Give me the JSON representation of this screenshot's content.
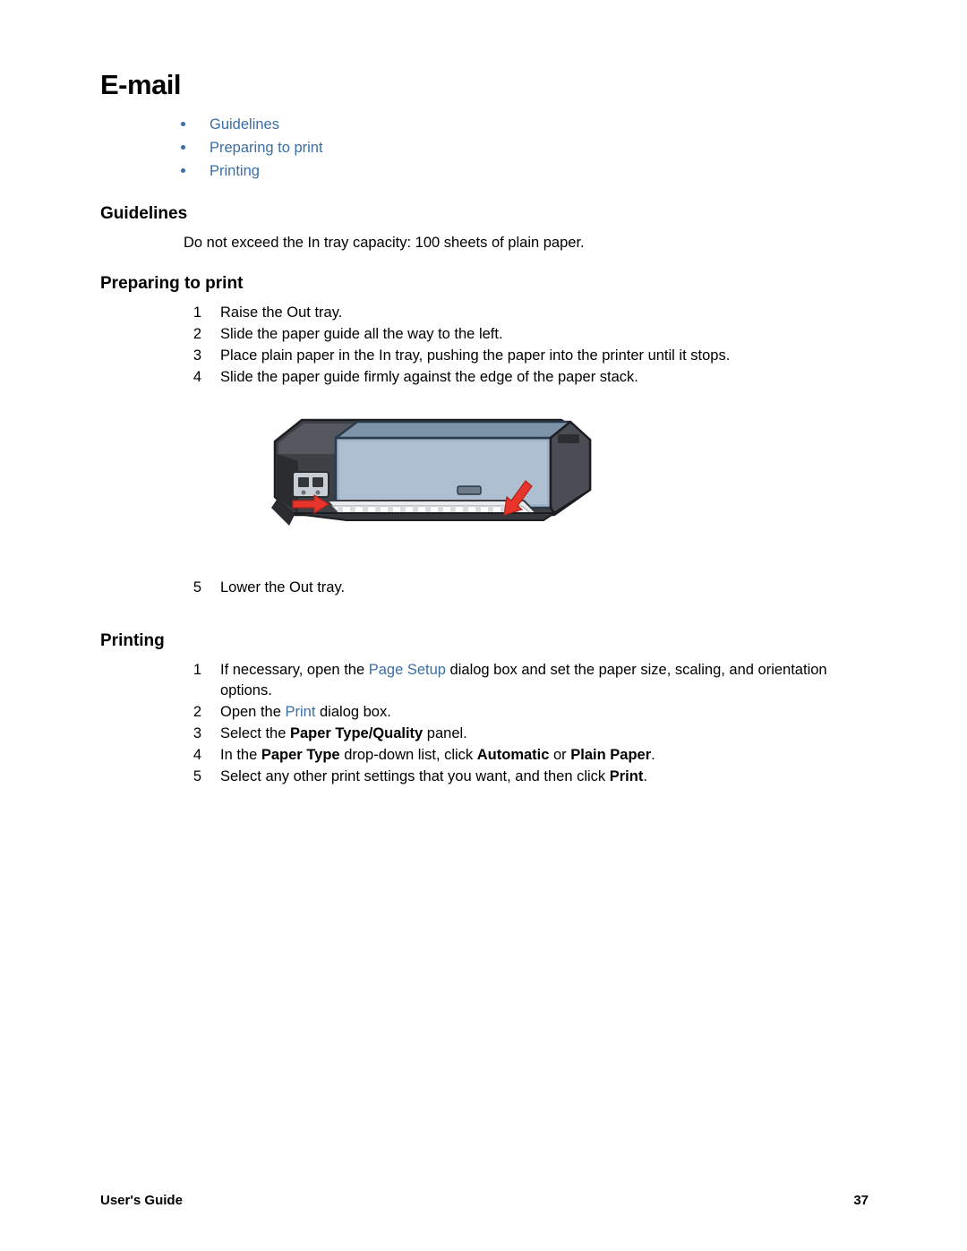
{
  "page": {
    "title": "E-mail",
    "toc": [
      {
        "label": "Guidelines"
      },
      {
        "label": "Preparing to print"
      },
      {
        "label": "Printing"
      }
    ],
    "sections": {
      "guidelines": {
        "heading": "Guidelines",
        "paragraph": "Do not exceed the In tray capacity: 100 sheets of plain paper."
      },
      "preparing": {
        "heading": "Preparing to print",
        "steps": [
          {
            "num": "1",
            "text": "Raise the Out tray."
          },
          {
            "num": "2",
            "text": "Slide the paper guide all the way to the left."
          },
          {
            "num": "3",
            "text": "Place plain paper in the In tray, pushing the paper into the printer until it stops."
          },
          {
            "num": "4",
            "text": "Slide the paper guide firmly against the edge of the paper stack."
          }
        ],
        "final_step": {
          "num": "5",
          "text": "Lower the Out tray."
        },
        "figure_alt": "printer-illustration"
      },
      "printing": {
        "heading": "Printing",
        "steps": [
          {
            "num": "1",
            "parts": [
              {
                "text": "If necessary, open the ",
                "style": "plain"
              },
              {
                "text": "Page Setup",
                "style": "link"
              },
              {
                "text": " dialog box and set the paper size, scaling, and orientation options.",
                "style": "plain"
              }
            ]
          },
          {
            "num": "2",
            "parts": [
              {
                "text": "Open the ",
                "style": "plain"
              },
              {
                "text": "Print",
                "style": "link"
              },
              {
                "text": " dialog box.",
                "style": "plain"
              }
            ]
          },
          {
            "num": "3",
            "parts": [
              {
                "text": "Select the ",
                "style": "plain"
              },
              {
                "text": "Paper Type/Quality",
                "style": "bold"
              },
              {
                "text": " panel.",
                "style": "plain"
              }
            ]
          },
          {
            "num": "4",
            "parts": [
              {
                "text": "In the ",
                "style": "plain"
              },
              {
                "text": "Paper Type",
                "style": "bold"
              },
              {
                "text": " drop-down list, click ",
                "style": "plain"
              },
              {
                "text": "Automatic",
                "style": "bold"
              },
              {
                "text": " or ",
                "style": "plain"
              },
              {
                "text": "Plain Paper",
                "style": "bold"
              },
              {
                "text": ".",
                "style": "plain"
              }
            ]
          },
          {
            "num": "5",
            "parts": [
              {
                "text": "Select any other print settings that you want, and then click ",
                "style": "plain"
              },
              {
                "text": "Print",
                "style": "bold"
              },
              {
                "text": ".",
                "style": "plain"
              }
            ]
          }
        ]
      }
    },
    "footer": {
      "label": "User's Guide",
      "page_number": "37"
    },
    "colors": {
      "link": "#3b6ea5",
      "text": "#000000",
      "background": "#ffffff",
      "arrow": "#e8352b"
    }
  }
}
